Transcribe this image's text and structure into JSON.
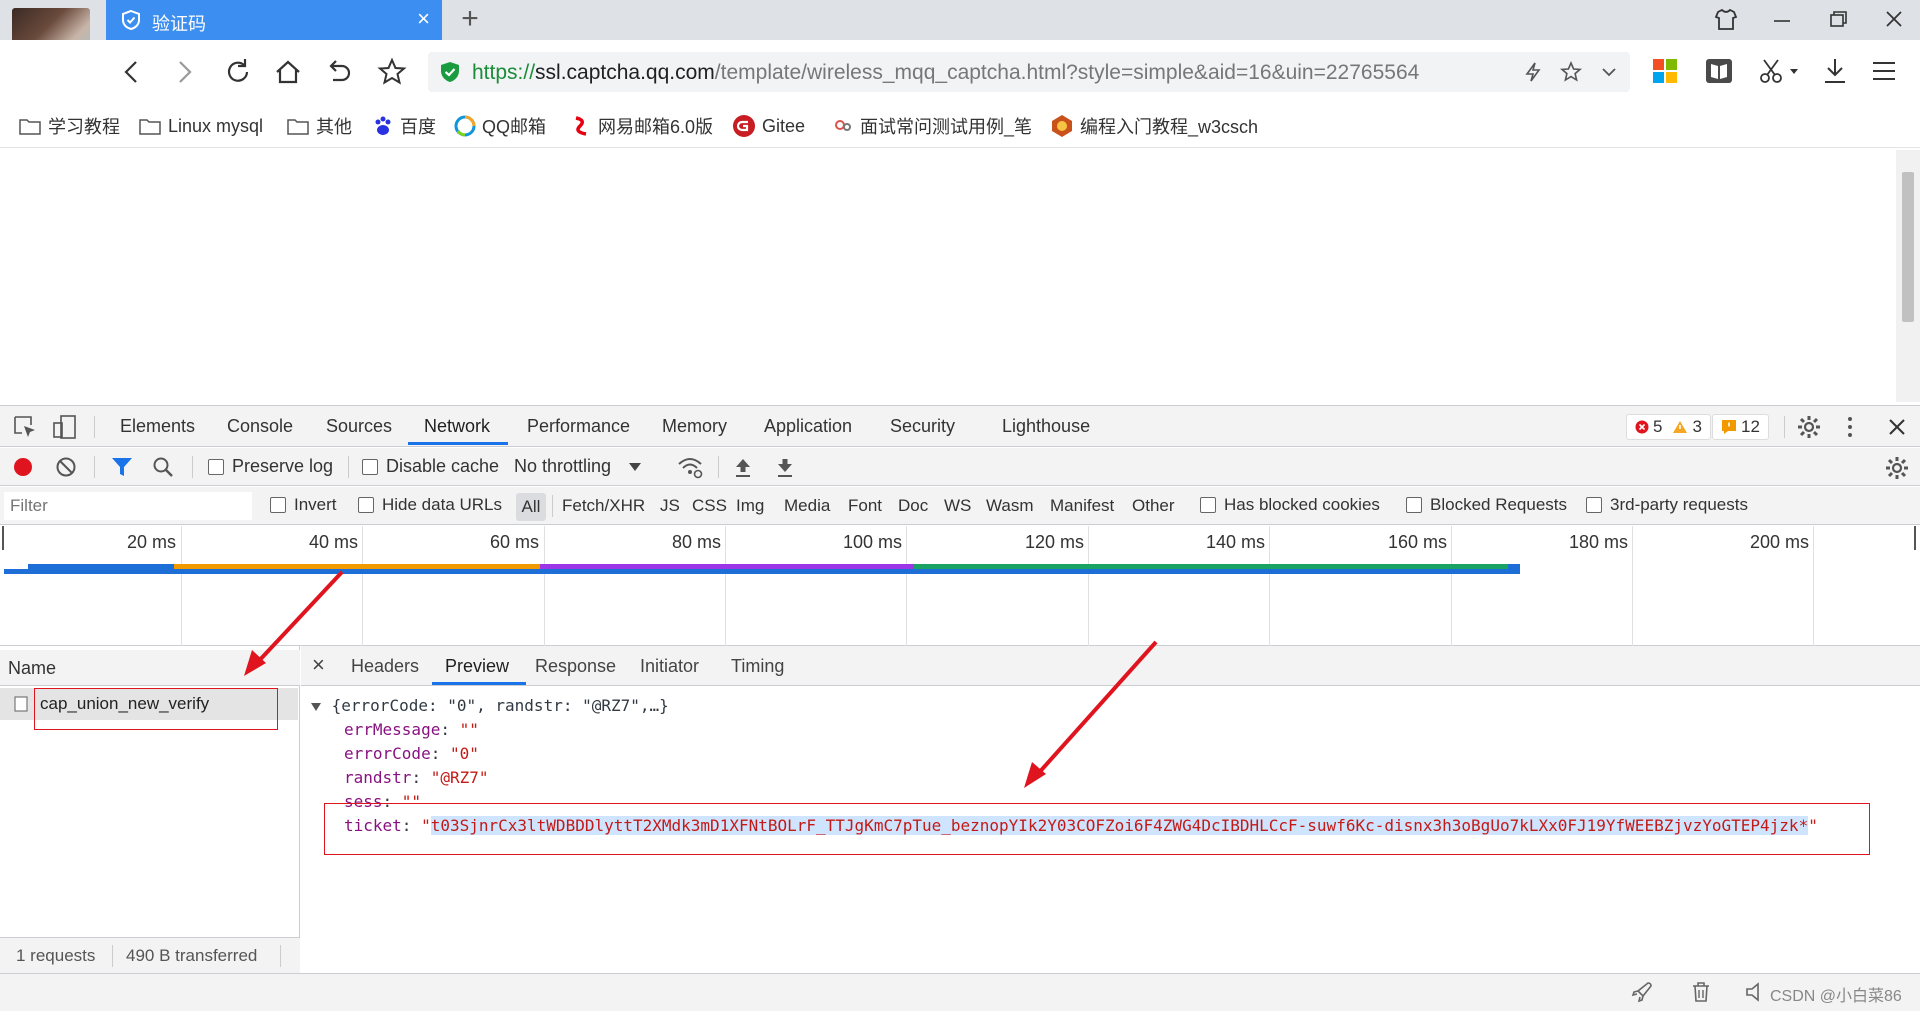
{
  "browser": {
    "tab_title": "验证码",
    "url": {
      "scheme": "https://",
      "host": "ssl.captcha.qq.com",
      "path": "/template/wireless_mqq_captcha.html?style=simple&aid=16&uin=22765564"
    }
  },
  "bookmarks": [
    {
      "label": "学习教程",
      "icon": "folder-icon"
    },
    {
      "label": "Linux mysql",
      "icon": "folder-icon"
    },
    {
      "label": "其他",
      "icon": "folder-icon"
    },
    {
      "label": "百度",
      "icon": "baidu-icon"
    },
    {
      "label": "QQ邮箱",
      "icon": "qqmail-icon"
    },
    {
      "label": "网易邮箱6.0版",
      "icon": "netease-icon"
    },
    {
      "label": "Gitee",
      "icon": "gitee-icon"
    },
    {
      "label": "面试常问测试用例_笔",
      "icon": "blog-icon"
    },
    {
      "label": "编程入门教程_w3csch",
      "icon": "w3c-icon"
    }
  ],
  "devtools": {
    "tabs": [
      "Elements",
      "Console",
      "Sources",
      "Network",
      "Performance",
      "Memory",
      "Application",
      "Security",
      "Lighthouse"
    ],
    "active_tab": "Network",
    "badges": {
      "errors": "5",
      "warnings": "3",
      "issues": "12"
    },
    "toolbar": {
      "preserve_log": "Preserve log",
      "disable_cache": "Disable cache",
      "throttling": "No throttling"
    },
    "filterbar": {
      "filter_placeholder": "Filter",
      "invert": "Invert",
      "hide_data_urls": "Hide data URLs",
      "types": [
        "All",
        "Fetch/XHR",
        "JS",
        "CSS",
        "Img",
        "Media",
        "Font",
        "Doc",
        "WS",
        "Wasm",
        "Manifest",
        "Other"
      ],
      "has_blocked_cookies": "Has blocked cookies",
      "blocked_requests": "Blocked Requests",
      "third_party": "3rd-party requests"
    },
    "overview_ticks": [
      "20 ms",
      "40 ms",
      "60 ms",
      "80 ms",
      "100 ms",
      "120 ms",
      "140 ms",
      "160 ms",
      "180 ms",
      "200 ms"
    ],
    "name_header": "Name",
    "request_name": "cap_union_new_verify",
    "status": {
      "requests": "1 requests",
      "transferred": "490 B transferred"
    },
    "detail_tabs": [
      "Headers",
      "Preview",
      "Response",
      "Initiator",
      "Timing"
    ],
    "active_detail_tab": "Preview",
    "preview": {
      "summary": "{errorCode: \"0\", randstr: \"@RZ7\",…}",
      "errMessage_key": "errMessage",
      "errMessage_val": "\"\"",
      "errorCode_key": "errorCode",
      "errorCode_val": "\"0\"",
      "randstr_key": "randstr",
      "randstr_val": "\"@RZ7\"",
      "sess_key": "sess",
      "sess_val": "\"\"",
      "ticket_key": "ticket",
      "ticket_val": "t03SjnrCx3ltWDBDDlyttT2XMdk3mD1XFNtBOLrF_TTJgKmC7pTue_beznopYIk2Y03COFZoi6F4ZWG4DcIBDHLCcF-suwf6Kc-disnx3h3oBgUo7kLXx0FJ19YfWEEBZjvzYoGTEP4jzk*"
    }
  },
  "watermark": "CSDN @小白菜86",
  "colors": {
    "tab_active": "#3c8ff0",
    "accent": "#1a73e8",
    "annotation": "#e0141e"
  }
}
